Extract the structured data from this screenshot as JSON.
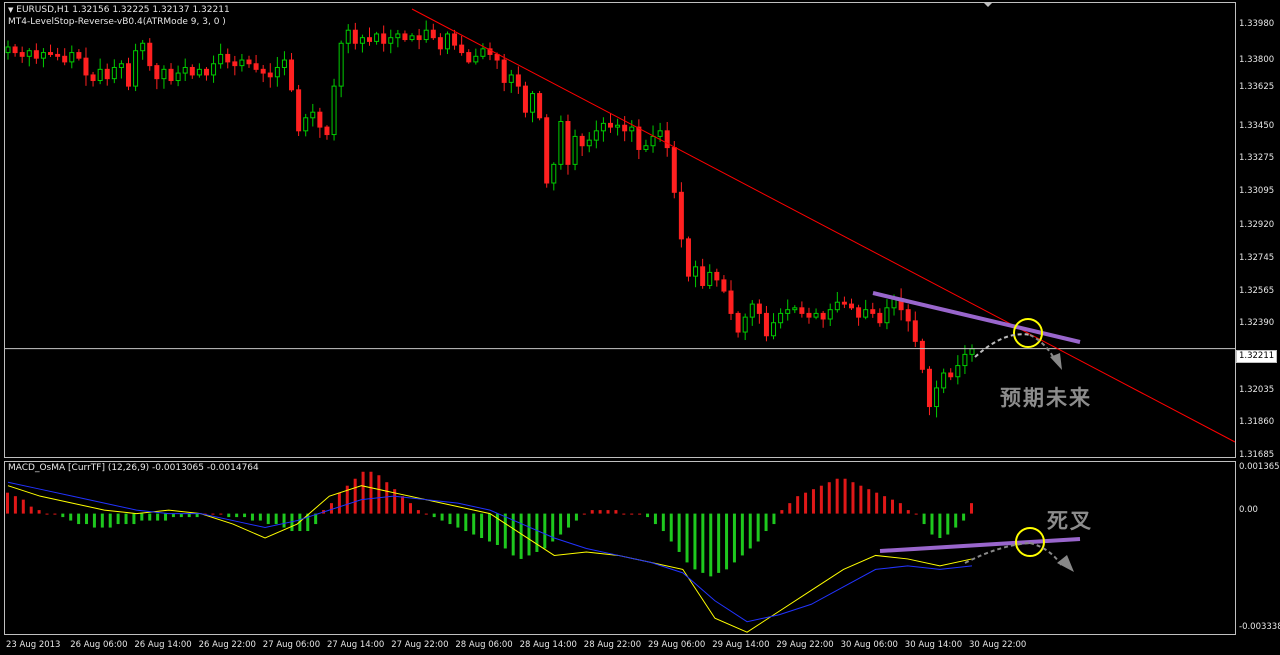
{
  "symbol_title": "EURUSD,H1  1.32156  1.32225  1.32137  1.32211",
  "indicator_title": "MT4-LevelStop-Reverse-vB0.4(ATRMode 9, 3, 0 )",
  "sub_indicator_title": "MACD_OsMA [CurrTF] (12,26,9) -0.0013065 -0.0014764",
  "current_price": "1.32211",
  "price_axis": [
    "1.33980",
    "1.33800",
    "1.33625",
    "1.33450",
    "1.33275",
    "1.33095",
    "1.32920",
    "1.32745",
    "1.32565",
    "1.32390",
    "1.32035",
    "1.31860",
    "1.31685"
  ],
  "sub_axis": [
    "0.001365",
    "0.00",
    "-0.003338"
  ],
  "time_axis": [
    "23 Aug 2013",
    "26 Aug 06:00",
    "26 Aug 14:00",
    "26 Aug 22:00",
    "27 Aug 06:00",
    "27 Aug 14:00",
    "27 Aug 22:00",
    "28 Aug 06:00",
    "28 Aug 14:00",
    "28 Aug 22:00",
    "29 Aug 06:00",
    "29 Aug 14:00",
    "29 Aug 22:00",
    "30 Aug 06:00",
    "30 Aug 14:00",
    "30 Aug 22:00"
  ],
  "annotations": {
    "future": "预期未来",
    "death_cross": "死叉"
  },
  "colors": {
    "bull": "#00cc00",
    "bear": "#ff2020",
    "hist_pos": "#e01818",
    "hist_neg": "#1ec81e",
    "macd": "#ffff00",
    "signal": "#2233ff",
    "trendline": "#ff0000",
    "purple": "#9966cc",
    "circle": "#ffff00"
  },
  "chart_data": [
    {
      "type": "candlestick",
      "title": "EURUSD,H1",
      "ylim": [
        1.3164,
        1.3405
      ],
      "close_path": [
        1.3383,
        1.338,
        1.3378,
        1.3381,
        1.3377,
        1.338,
        1.3379,
        1.3378,
        1.3375,
        1.338,
        1.3377,
        1.3368,
        1.3365,
        1.3371,
        1.3366,
        1.3372,
        1.3374,
        1.3362,
        1.3381,
        1.3385,
        1.3373,
        1.3366,
        1.3371,
        1.3365,
        1.3369,
        1.3372,
        1.3368,
        1.3371,
        1.3368,
        1.3374,
        1.3379,
        1.3375,
        1.3373,
        1.3376,
        1.3374,
        1.3371,
        1.3369,
        1.3367,
        1.3372,
        1.3376,
        1.336,
        1.3338,
        1.3345,
        1.3348,
        1.334,
        1.3336,
        1.3362,
        1.3385,
        1.3392,
        1.3385,
        1.3388,
        1.3386,
        1.339,
        1.3385,
        1.3388,
        1.339,
        1.3387,
        1.3389,
        1.3387,
        1.3392,
        1.3388,
        1.3382,
        1.339,
        1.3384,
        1.338,
        1.3375,
        1.3378,
        1.3382,
        1.3379,
        1.3376,
        1.3364,
        1.3368,
        1.3362,
        1.3348,
        1.3358,
        1.3345,
        1.331,
        1.332,
        1.3343,
        1.332,
        1.3335,
        1.333,
        1.3333,
        1.3338,
        1.3342,
        1.334,
        1.3341,
        1.3338,
        1.334,
        1.3328,
        1.333,
        1.3335,
        1.3338,
        1.3329,
        1.3305,
        1.328,
        1.326,
        1.3265,
        1.3255,
        1.3262,
        1.3258,
        1.3252,
        1.324,
        1.323,
        1.3238,
        1.3245,
        1.324,
        1.3228,
        1.3235,
        1.324,
        1.3242,
        1.3243,
        1.324,
        1.3238,
        1.324,
        1.3237,
        1.3242,
        1.3246,
        1.3245,
        1.3243,
        1.3238,
        1.3242,
        1.324,
        1.3235,
        1.3243,
        1.3248,
        1.3242,
        1.3236,
        1.3225,
        1.321,
        1.319,
        1.32,
        1.3208,
        1.3206,
        1.3212,
        1.3218,
        1.3221
      ]
    },
    {
      "type": "histogram",
      "title": "MACD_OsMA [CurrTF] (12,26,9)",
      "ylim": [
        -0.003338,
        0.001365
      ],
      "osma": [
        0.0006,
        0.0005,
        0.0004,
        0.0002,
        0.0001,
        0.0,
        0.0,
        -0.0001,
        -0.0002,
        -0.0003,
        -0.0003,
        -0.0004,
        -0.0004,
        -0.0004,
        -0.0003,
        -0.0003,
        -0.0003,
        -0.0002,
        -0.0002,
        -0.0002,
        -0.0002,
        -0.0001,
        -0.0001,
        -0.0001,
        -0.0001,
        0.0,
        0.0,
        0.0,
        -0.0001,
        -0.0001,
        -0.0001,
        -0.0002,
        -0.0002,
        -0.0003,
        -0.0003,
        -0.0004,
        -0.0005,
        -0.0005,
        -0.0005,
        -0.0003,
        0.0001,
        0.0003,
        0.0006,
        0.0008,
        0.001,
        0.0012,
        0.0012,
        0.0011,
        0.0009,
        0.0007,
        0.0005,
        0.0003,
        0.0001,
        0.0,
        -0.0001,
        -0.0002,
        -0.0003,
        -0.0004,
        -0.0005,
        -0.0006,
        -0.0007,
        -0.0008,
        -0.0009,
        -0.001,
        -0.0012,
        -0.0013,
        -0.0012,
        -0.0011,
        -0.001,
        -0.0008,
        -0.0006,
        -0.0004,
        -0.0002,
        0.0,
        0.0001,
        0.0001,
        0.0001,
        0.0001,
        0.0,
        0.0,
        0.0,
        -0.0001,
        -0.0003,
        -0.0005,
        -0.0008,
        -0.0011,
        -0.0014,
        -0.0016,
        -0.0017,
        -0.0018,
        -0.0017,
        -0.0016,
        -0.0014,
        -0.0012,
        -0.001,
        -0.0008,
        -0.0005,
        -0.0003,
        0.0001,
        0.0003,
        0.0005,
        0.0006,
        0.0007,
        0.0008,
        0.0009,
        0.001,
        0.001,
        0.0009,
        0.0008,
        0.0007,
        0.0006,
        0.0005,
        0.0004,
        0.0003,
        0.0001,
        0.0,
        -0.0003,
        -0.0006,
        -0.0007,
        -0.0006,
        -0.0004,
        -0.0002,
        0.0003
      ]
    }
  ]
}
